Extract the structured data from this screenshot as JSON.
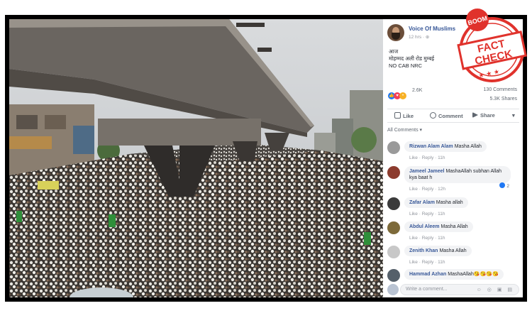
{
  "post": {
    "page_name": "Voice Of Muslims",
    "time": "12 hrs",
    "privacy_icon": "globe-icon",
    "text_line1": "आज",
    "text_line2": "मोहम्मद अली रोड मुम्बई",
    "text_line3": "NO CAB NRC",
    "reaction_count": "2.6K",
    "comments_count": "130 Comments",
    "shares_count": "5.3K Shares"
  },
  "actions": {
    "like": "Like",
    "comment": "Comment",
    "share": "Share"
  },
  "comments_filter": "All Comments ▾",
  "comments": [
    {
      "name": "Rizwan Alam Alam",
      "text": "Masha Allah",
      "time": "11h",
      "avatar_color": "#9a9a9a"
    },
    {
      "name": "Jameel Jameel",
      "text": "MashaAllah subhan Allah kya baat h",
      "time": "12h",
      "avatar_color": "#8c3b2e",
      "reactions": "2"
    },
    {
      "name": "Zafar Alam",
      "text": "Masha allah",
      "time": "11h",
      "avatar_color": "#3b3b3b"
    },
    {
      "name": "Abdul Aleem",
      "text": "Masha Allah",
      "time": "11h",
      "avatar_color": "#7d6a3a"
    },
    {
      "name": "Zenith Khan",
      "text": "Masha Allah",
      "time": "11h",
      "avatar_color": "#c8c8c8"
    },
    {
      "name": "Hammad Azhan",
      "text": "MashaAllah",
      "emojis": "😘😘😘😘",
      "avatar_color": "#55606a"
    }
  ],
  "comment_meta": {
    "like": "Like",
    "reply": "Reply"
  },
  "composer": {
    "placeholder": "Write a comment...",
    "tools": "☺ ◎ ▣ ▤"
  },
  "stamp": {
    "top": "BOOM",
    "line1": "FACT",
    "line2": "CHECK",
    "color": "#e0322c"
  }
}
